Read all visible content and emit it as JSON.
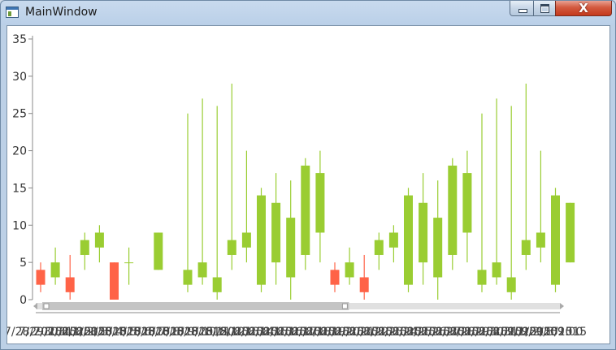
{
  "window": {
    "title": "MainWindow",
    "minimize_icon": "minimize-icon",
    "maximize_icon": "maximize-icon",
    "close_label": "X"
  },
  "colors": {
    "up": "#9acd32",
    "down": "#ff6347",
    "scrollbar": "#c4c4c4",
    "axis": "#888888"
  },
  "chart_data": {
    "type": "candlestick",
    "title": "",
    "xlabel": "",
    "ylabel": "",
    "ylim": [
      0,
      35
    ],
    "yticks": [
      0,
      5,
      10,
      15,
      20,
      25,
      30,
      35
    ],
    "x_tick_labels": [
      "7/28/2015",
      "7/29/2015",
      "7/30/2015",
      "7/31/2015",
      "8/1/2015",
      "8/2/2015",
      "8/3/2015",
      "8/4/2015",
      "8/5/2015",
      "8/6/2015",
      "8/7/2015",
      "8/8/2015",
      "8/9/2015",
      "8/10/2015",
      "8/11/2015",
      "8/12/2015",
      "8/13/2015",
      "8/14/2015",
      "8/15/2015",
      "8/16/2015",
      "8/17/2015",
      "8/18/2015",
      "8/19/2015",
      "8/20/2015",
      "8/21/2015",
      "8/22/2015",
      "8/23/2015",
      "8/24/2015",
      "8/25/2015",
      "8/26/2015",
      "8/27/2015",
      "8/28/2015",
      "8/29/2015",
      "8/30/2015",
      "8/31/2015",
      "9/1/2015",
      "9/2/2015",
      "9/3/2015",
      "09:00"
    ],
    "candles": [
      {
        "open": 4,
        "close": 2,
        "high": 5,
        "low": 1
      },
      {
        "open": 3,
        "close": 5,
        "high": 7,
        "low": 2
      },
      {
        "open": 3,
        "close": 1,
        "high": 6,
        "low": 0
      },
      {
        "open": 6,
        "close": 8,
        "high": 9,
        "low": 4
      },
      {
        "open": 7,
        "close": 9,
        "high": 10,
        "low": 5
      },
      {
        "open": 5,
        "close": 0,
        "high": 5,
        "low": 0
      },
      {
        "open": 5,
        "close": 5,
        "high": 7,
        "low": 2
      },
      {
        "open": null,
        "close": null,
        "high": null,
        "low": null
      },
      {
        "open": 4,
        "close": 9,
        "high": 9,
        "low": 4
      },
      {
        "open": null,
        "close": null,
        "high": null,
        "low": null
      },
      {
        "open": 2,
        "close": 4,
        "high": 25,
        "low": 1
      },
      {
        "open": 3,
        "close": 5,
        "high": 27,
        "low": 2
      },
      {
        "open": 1,
        "close": 3,
        "high": 26,
        "low": 0
      },
      {
        "open": 6,
        "close": 8,
        "high": 29,
        "low": 4
      },
      {
        "open": 7,
        "close": 9,
        "high": 20,
        "low": 5
      },
      {
        "open": 2,
        "close": 14,
        "high": 15,
        "low": 1
      },
      {
        "open": 5,
        "close": 13,
        "high": 17,
        "low": 2
      },
      {
        "open": 3,
        "close": 11,
        "high": 16,
        "low": 0
      },
      {
        "open": 6,
        "close": 18,
        "high": 19,
        "low": 4
      },
      {
        "open": 9,
        "close": 17,
        "high": 20,
        "low": 5
      },
      {
        "open": 4,
        "close": 2,
        "high": 5,
        "low": 1
      },
      {
        "open": 3,
        "close": 5,
        "high": 7,
        "low": 2
      },
      {
        "open": 3,
        "close": 1,
        "high": 6,
        "low": 0
      },
      {
        "open": 6,
        "close": 8,
        "high": 9,
        "low": 4
      },
      {
        "open": 7,
        "close": 9,
        "high": 10,
        "low": 5
      },
      {
        "open": 2,
        "close": 14,
        "high": 15,
        "low": 1
      },
      {
        "open": 5,
        "close": 13,
        "high": 17,
        "low": 2
      },
      {
        "open": 3,
        "close": 11,
        "high": 16,
        "low": 0
      },
      {
        "open": 6,
        "close": 18,
        "high": 19,
        "low": 4
      },
      {
        "open": 9,
        "close": 17,
        "high": 20,
        "low": 5
      },
      {
        "open": 2,
        "close": 4,
        "high": 25,
        "low": 1
      },
      {
        "open": 3,
        "close": 5,
        "high": 27,
        "low": 2
      },
      {
        "open": 1,
        "close": 3,
        "high": 26,
        "low": 0
      },
      {
        "open": 6,
        "close": 8,
        "high": 29,
        "low": 4
      },
      {
        "open": 7,
        "close": 9,
        "high": 20,
        "low": 5
      },
      {
        "open": 2,
        "close": 14,
        "high": 15,
        "low": 1
      },
      {
        "open": 5,
        "close": 13,
        "high": 13,
        "low": 5
      }
    ],
    "scrollbar": {
      "start": 0.0,
      "end": 0.6
    },
    "grid": false,
    "legend": "none"
  }
}
